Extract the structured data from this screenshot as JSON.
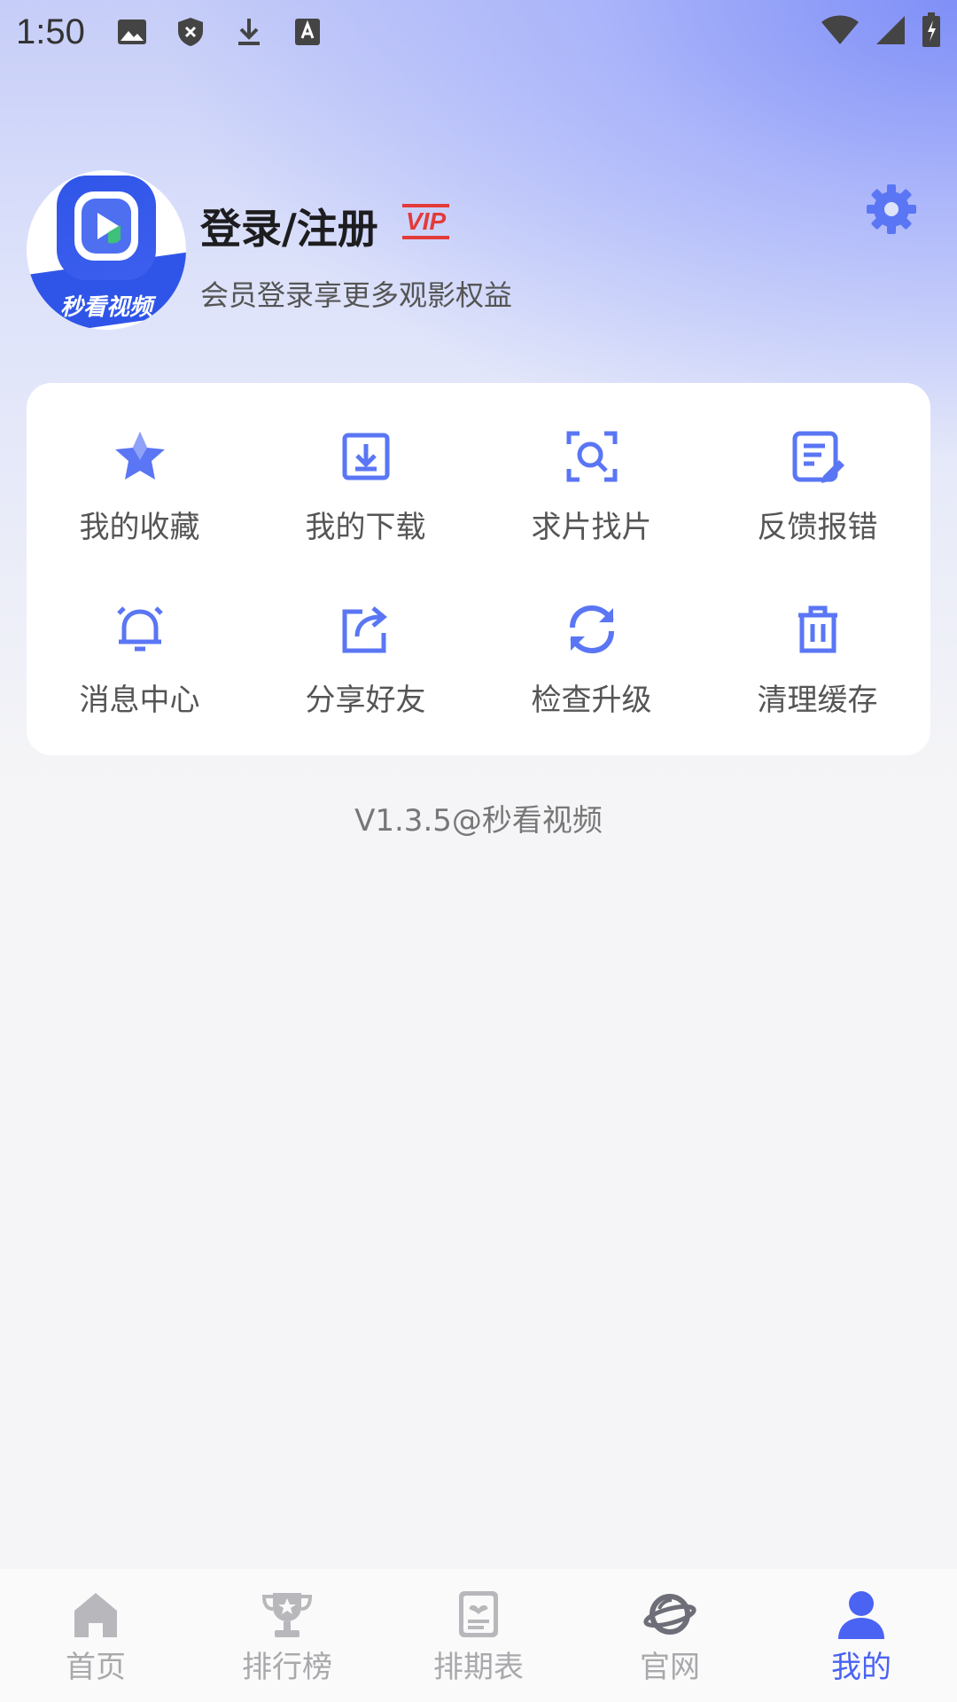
{
  "status_bar": {
    "time": "1:50"
  },
  "profile": {
    "title": "登录/注册",
    "vip": "VIP",
    "subtitle": "会员登录享更多观影权益",
    "avatar_text": "秒看视频"
  },
  "menu": [
    {
      "label": "我的收藏",
      "icon": "star-icon"
    },
    {
      "label": "我的下载",
      "icon": "download-icon"
    },
    {
      "label": "求片找片",
      "icon": "search-scan-icon"
    },
    {
      "label": "反馈报错",
      "icon": "feedback-edit-icon"
    },
    {
      "label": "消息中心",
      "icon": "bell-icon"
    },
    {
      "label": "分享好友",
      "icon": "share-icon"
    },
    {
      "label": "检查升级",
      "icon": "refresh-icon"
    },
    {
      "label": "清理缓存",
      "icon": "trash-icon"
    }
  ],
  "version": "V1.3.5@秒看视频",
  "tabs": [
    {
      "label": "首页",
      "icon": "home-icon",
      "active": false
    },
    {
      "label": "排行榜",
      "icon": "trophy-icon",
      "active": false
    },
    {
      "label": "排期表",
      "icon": "schedule-icon",
      "active": false
    },
    {
      "label": "官网",
      "icon": "planet-icon",
      "active": false
    },
    {
      "label": "我的",
      "icon": "user-icon",
      "active": true
    }
  ],
  "colors": {
    "accent": "#4a63f3",
    "icon_blue": "#5a76f5",
    "vip_red": "#e33a3a"
  }
}
